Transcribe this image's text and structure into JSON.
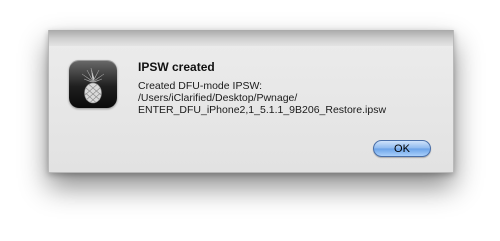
{
  "dialog": {
    "title": "IPSW created",
    "message_lines": [
      "Created DFU-mode IPSW:",
      "/Users/iClarified/Desktop/Pwnage/",
      "ENTER_DFU_iPhone2,1_5.1.1_9B206_Restore.ipsw"
    ],
    "ok_label": "OK",
    "icon": "pineapple-icon"
  },
  "colors": {
    "button_accent": "#8db8ee",
    "dialog_background": "#e8e8e8",
    "icon_background": "#1f1f1f"
  }
}
